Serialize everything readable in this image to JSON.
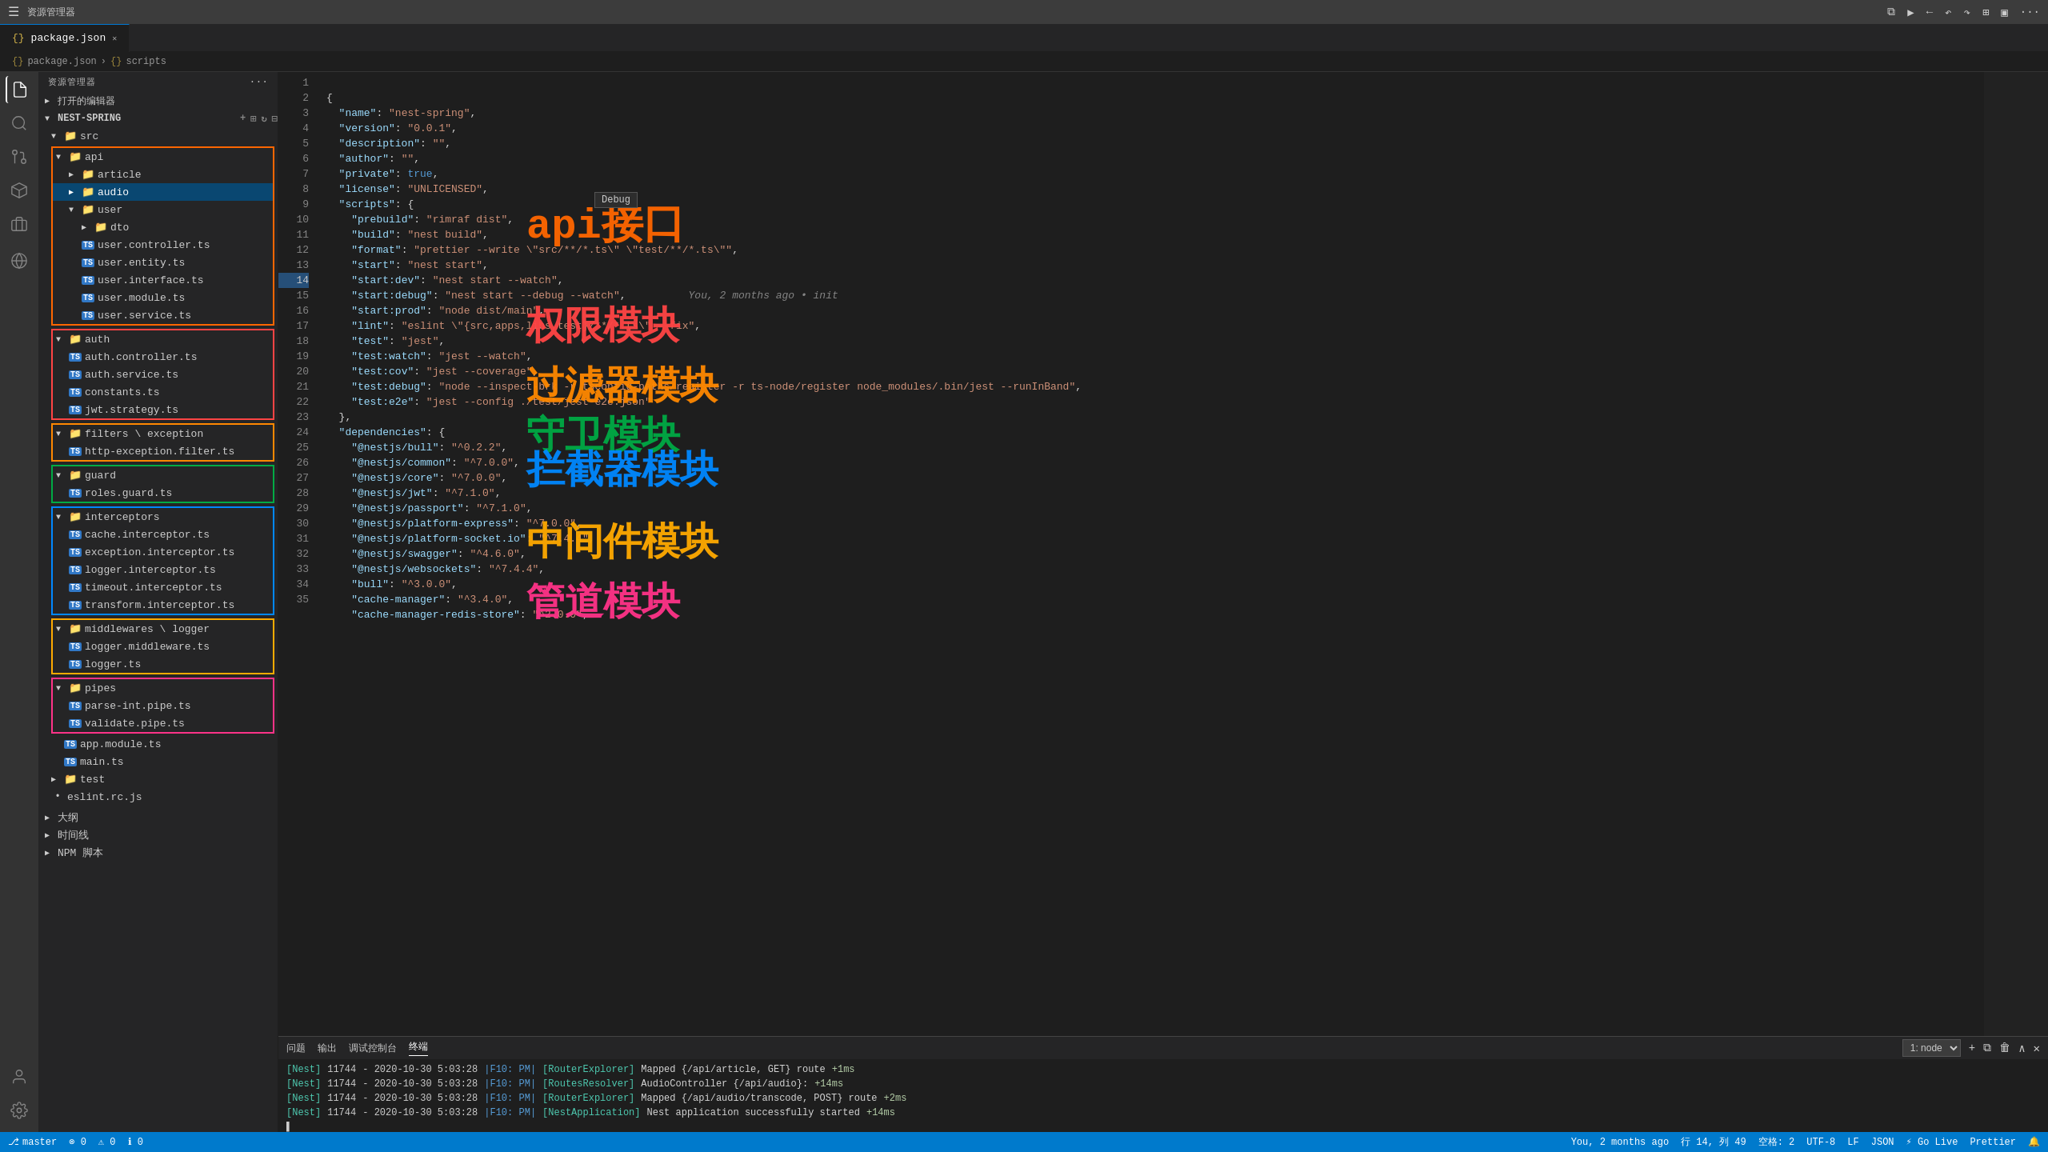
{
  "titlebar": {
    "title": "资源管理器",
    "tab_label": "package.json",
    "close_icon": "✕"
  },
  "breadcrumb": {
    "items": [
      "package.json",
      "scripts"
    ]
  },
  "sidebar": {
    "header": "资源管理器",
    "project_label": "打开的编辑器",
    "root_label": "NEST-SPRING",
    "tree": [
      {
        "label": "src",
        "type": "folder",
        "indent": 0,
        "expanded": true
      },
      {
        "label": "api",
        "type": "folder",
        "indent": 1,
        "expanded": true,
        "boxed": "api"
      },
      {
        "label": "article",
        "type": "folder",
        "indent": 2,
        "expanded": false
      },
      {
        "label": "audio",
        "type": "folder",
        "indent": 2,
        "expanded": false,
        "selected": true
      },
      {
        "label": "user",
        "type": "folder",
        "indent": 2,
        "expanded": true
      },
      {
        "label": "dto",
        "type": "folder",
        "indent": 3,
        "expanded": false
      },
      {
        "label": "user.controller.ts",
        "type": "ts",
        "indent": 3
      },
      {
        "label": "user.entity.ts",
        "type": "ts",
        "indent": 3
      },
      {
        "label": "user.interface.ts",
        "type": "ts",
        "indent": 3
      },
      {
        "label": "user.module.ts",
        "type": "ts",
        "indent": 3
      },
      {
        "label": "user.service.ts",
        "type": "ts",
        "indent": 3
      },
      {
        "label": "auth",
        "type": "folder",
        "indent": 1,
        "expanded": true,
        "boxed": "auth"
      },
      {
        "label": "auth.controller.ts",
        "type": "ts",
        "indent": 2
      },
      {
        "label": "auth.service.ts",
        "type": "ts",
        "indent": 2
      },
      {
        "label": "constants.ts",
        "type": "ts",
        "indent": 2
      },
      {
        "label": "jwt.strategy.ts",
        "type": "ts",
        "indent": 2
      },
      {
        "label": "filters \\ exception",
        "type": "folder",
        "indent": 1,
        "expanded": true,
        "boxed": "filter"
      },
      {
        "label": "http-exception.filter.ts",
        "type": "ts",
        "indent": 2
      },
      {
        "label": "guard",
        "type": "folder",
        "indent": 1,
        "expanded": true,
        "boxed": "guard"
      },
      {
        "label": "roles.guard.ts",
        "type": "ts",
        "indent": 2
      },
      {
        "label": "interceptors",
        "type": "folder",
        "indent": 1,
        "expanded": true,
        "boxed": "interceptor"
      },
      {
        "label": "cache.interceptor.ts",
        "type": "ts",
        "indent": 2
      },
      {
        "label": "exception.interceptor.ts",
        "type": "ts",
        "indent": 2
      },
      {
        "label": "logger.interceptor.ts",
        "type": "ts",
        "indent": 2
      },
      {
        "label": "timeout.interceptor.ts",
        "type": "ts",
        "indent": 2
      },
      {
        "label": "transform.interceptor.ts",
        "type": "ts",
        "indent": 2
      },
      {
        "label": "middlewares \\ logger",
        "type": "folder",
        "indent": 1,
        "expanded": true,
        "boxed": "middleware"
      },
      {
        "label": "logger.middleware.ts",
        "type": "ts",
        "indent": 2
      },
      {
        "label": "logger.ts",
        "type": "ts",
        "indent": 2
      },
      {
        "label": "pipes",
        "type": "folder",
        "indent": 1,
        "expanded": true,
        "boxed": "pipe"
      },
      {
        "label": "parse-int.pipe.ts",
        "type": "ts",
        "indent": 2
      },
      {
        "label": "validate.pipe.ts",
        "type": "ts",
        "indent": 2
      },
      {
        "label": "app.module.ts",
        "type": "ts",
        "indent": 1
      },
      {
        "label": "main.ts",
        "type": "ts",
        "indent": 1
      },
      {
        "label": "test",
        "type": "folder",
        "indent": 0,
        "expanded": false
      },
      {
        "label": "eslint.rc.js",
        "type": "file",
        "indent": 0
      },
      {
        "label": "大纲",
        "type": "section"
      },
      {
        "label": "时间线",
        "type": "section"
      },
      {
        "label": "NPM 脚本",
        "type": "section"
      }
    ]
  },
  "code": {
    "lines": [
      {
        "n": 1,
        "text": "{"
      },
      {
        "n": 2,
        "text": "  \"name\": \"nest-spring\","
      },
      {
        "n": 3,
        "text": "  \"version\": \"0.0.1\","
      },
      {
        "n": 4,
        "text": "  \"description\": \"\","
      },
      {
        "n": 5,
        "text": "  \"author\": \"\","
      },
      {
        "n": 6,
        "text": "  \"private\": true,"
      },
      {
        "n": 7,
        "text": "  \"license\": \"UNLICENSED\","
      },
      {
        "n": 8,
        "text": "  \"scripts\": {"
      },
      {
        "n": 9,
        "text": "    \"prebuild\": \"rimraf dist\","
      },
      {
        "n": 10,
        "text": "    \"build\": \"nest build\","
      },
      {
        "n": 11,
        "text": "    \"format\": \"prettier --write \\\"src/**/*.ts\\\" \\\"test/**/*.ts\\\"\","
      },
      {
        "n": 12,
        "text": "    \"start\": \"nest start\","
      },
      {
        "n": 13,
        "text": "    \"start:dev\": \"nest start --watch\","
      },
      {
        "n": 14,
        "text": "    \"start:debug\": \"nest start --debug --watch\","
      },
      {
        "n": 15,
        "text": "    \"start:prod\": \"node dist/main\","
      },
      {
        "n": 16,
        "text": "    \"lint\": \"eslint \\\"{src,apps,libs,test}/**/*.ts\\\" --fix\","
      },
      {
        "n": 17,
        "text": "    \"test\": \"jest\","
      },
      {
        "n": 18,
        "text": "    \"test:watch\": \"jest --watch\","
      },
      {
        "n": 19,
        "text": "    \"test:cov\": \"jest --coverage\","
      },
      {
        "n": 20,
        "text": "    \"test:debug\": \"node --inspect-brk -r tsconfig-paths/register -r ts-node/register node_modules/.bin/jest --runInBand\","
      },
      {
        "n": 21,
        "text": "    \"test:e2e\": \"jest --config ./test/jest-e2e.json\""
      },
      {
        "n": 22,
        "text": "  },"
      },
      {
        "n": 23,
        "text": "  \"dependencies\": {"
      },
      {
        "n": 24,
        "text": "    \"@nestjs/bull\": \"^0.2.2\","
      },
      {
        "n": 25,
        "text": "    \"@nestjs/common\": \"^7.0.0\","
      },
      {
        "n": 26,
        "text": "    \"@nestjs/core\": \"^7.0.0\","
      },
      {
        "n": 27,
        "text": "    \"@nestjs/jwt\": \"^7.1.0\","
      },
      {
        "n": 28,
        "text": "    \"@nestjs/passport\": \"^7.1.0\","
      },
      {
        "n": 29,
        "text": "    \"@nestjs/platform-express\": \"^7.0.0\","
      },
      {
        "n": 30,
        "text": "    \"@nestjs/platform-socket.io\": \"^7.4.4\","
      },
      {
        "n": 31,
        "text": "    \"@nestjs/swagger\": \"^4.6.0\","
      },
      {
        "n": 32,
        "text": "    \"@nestjs/websockets\": \"^7.4.4\","
      },
      {
        "n": 33,
        "text": "    \"bull\": \"^3.0.0\","
      },
      {
        "n": 34,
        "text": "    \"cache-manager\": \"^3.4.0\","
      },
      {
        "n": 35,
        "text": "    \"cache-manager-redis-store\": \"^2.0.0\","
      }
    ],
    "git_blame": "You, 2 months ago • init"
  },
  "overlay_labels": [
    {
      "text": "api接口",
      "class": "label-api",
      "color": "#ff6600"
    },
    {
      "text": "权限模块",
      "class": "label-auth",
      "color": "#ff4444"
    },
    {
      "text": "过滤器模块",
      "class": "label-filter",
      "color": "#ff8800"
    },
    {
      "text": "守卫模块",
      "class": "label-guard",
      "color": "#00aa44"
    },
    {
      "text": "拦截器模块",
      "class": "label-interceptor",
      "color": "#0088ff"
    },
    {
      "text": "中间件模块",
      "class": "label-middleware",
      "color": "#ffaa00"
    },
    {
      "text": "管道模块",
      "class": "label-pipe",
      "color": "#ff3388"
    }
  ],
  "debug_tooltip": "Debug",
  "terminal": {
    "tabs": [
      "终端",
      "输出",
      "调试控制台",
      "问题"
    ],
    "active_tab": "终端",
    "select_value": "1: node",
    "lines": [
      {
        "nest": "[Nest]",
        "pid": "11744",
        "date": "- 2020-10-30 5:03:28",
        "level": "|F10: PM|",
        "tag": "[RouterExplorer]",
        "msg": "Mapped {/api/article, GET} route",
        "extra": "+1ms"
      },
      {
        "nest": "[Nest]",
        "pid": "11744",
        "date": "- 2020-10-30 5:03:28",
        "level": "|F10: PM|",
        "tag": "[RoutesResolver]",
        "msg": "AudioController {/api/audio}:",
        "extra": "+14ms"
      },
      {
        "nest": "[Nest]",
        "pid": "11744",
        "date": "- 2020-10-30 5:03:28",
        "level": "|F10: PM|",
        "tag": "[RouterExplorer]",
        "msg": "Mapped {/api/audio/transcode, POST} route",
        "extra": "+2ms"
      },
      {
        "nest": "[Nest]",
        "pid": "11744",
        "date": "- 2020-10-30 5:03:28",
        "level": "|F10: PM|",
        "tag": "[NestApplication]",
        "msg": "Nest application successfully started",
        "extra": "+14ms"
      }
    ],
    "cursor": "▌"
  },
  "statusbar": {
    "branch": "master",
    "errors": "⊗ 0",
    "warnings": "⚠ 0",
    "info": "ℹ 0",
    "git_sync": "You, 2 months ago",
    "line_col": "行 14, 列 49",
    "spaces": "空格: 2",
    "encoding": "UTF-8",
    "line_ending": "LF",
    "language": "JSON",
    "go_live": "⚡ Go Live",
    "prettier": "Prettier",
    "bell": "🔔"
  }
}
